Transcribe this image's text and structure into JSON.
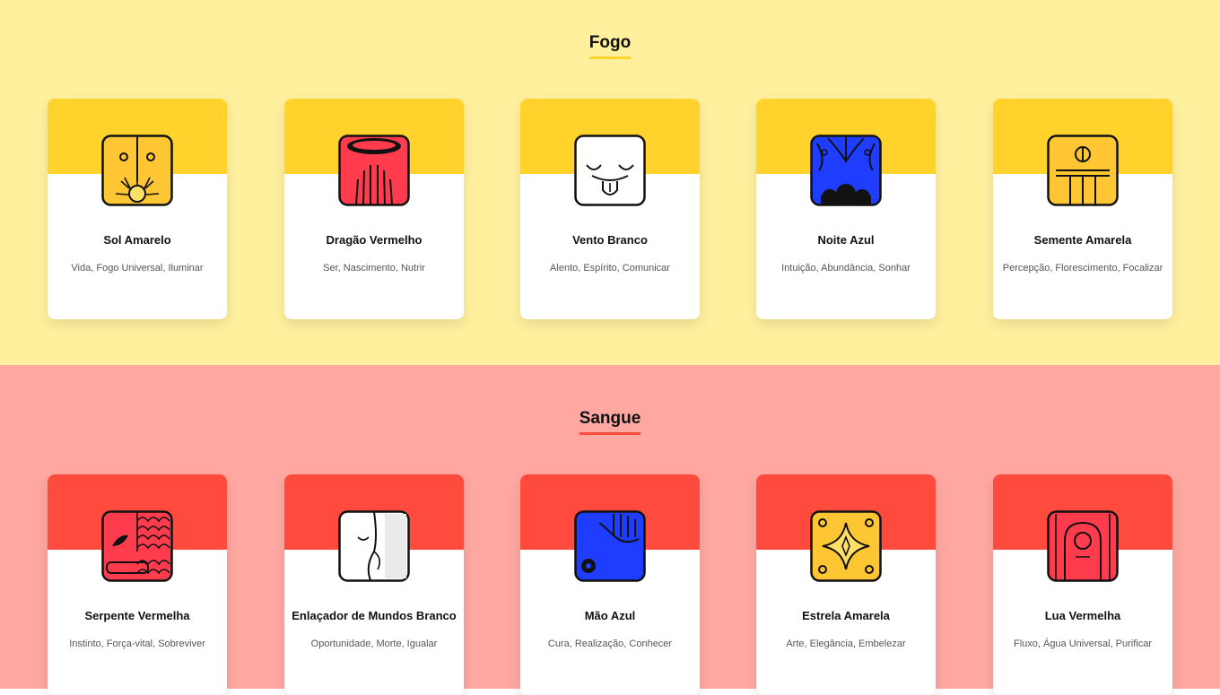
{
  "sections": [
    {
      "title": "Fogo",
      "cards": [
        {
          "name": "Sol Amarelo",
          "keywords": "Vida, Fogo Universal, Iluminar",
          "icon": "sol-amarelo-glyph-icon"
        },
        {
          "name": "Dragão Vermelho",
          "keywords": "Ser, Nascimento, Nutrir",
          "icon": "dragao-vermelho-glyph-icon"
        },
        {
          "name": "Vento Branco",
          "keywords": "Alento, Espírito, Comunicar",
          "icon": "vento-branco-glyph-icon"
        },
        {
          "name": "Noite Azul",
          "keywords": "Intuição, Abundância, Sonhar",
          "icon": "noite-azul-glyph-icon"
        },
        {
          "name": "Semente Amarela",
          "keywords": "Percepção, Florescimento, Focalizar",
          "icon": "semente-amarela-glyph-icon"
        }
      ]
    },
    {
      "title": "Sangue",
      "cards": [
        {
          "name": "Serpente Vermelha",
          "keywords": "Instinto, Força-vital, Sobreviver",
          "icon": "serpente-vermelha-glyph-icon"
        },
        {
          "name": "Enlaçador de Mundos Branco",
          "keywords": "Oportunidade, Morte, Igualar",
          "icon": "enlacador-mundos-branco-glyph-icon"
        },
        {
          "name": "Mão Azul",
          "keywords": "Cura, Realização, Conhecer",
          "icon": "mao-azul-glyph-icon"
        },
        {
          "name": "Estrela Amarela",
          "keywords": "Arte, Elegância, Embelezar",
          "icon": "estrela-amarela-glyph-icon"
        },
        {
          "name": "Lua Vermelha",
          "keywords": "Fluxo, Água Universal, Purificar",
          "icon": "lua-vermelha-glyph-icon"
        }
      ]
    }
  ],
  "colors": {
    "fogo_bg": "#fff09e",
    "fogo_accent": "#ffd22c",
    "sangue_bg": "#ffa8a2",
    "sangue_accent": "#ff4b3e",
    "glyph_yellow": "#ffc633",
    "glyph_red": "#ff3b4e",
    "glyph_blue": "#1f3dff",
    "glyph_white": "#ffffff"
  }
}
